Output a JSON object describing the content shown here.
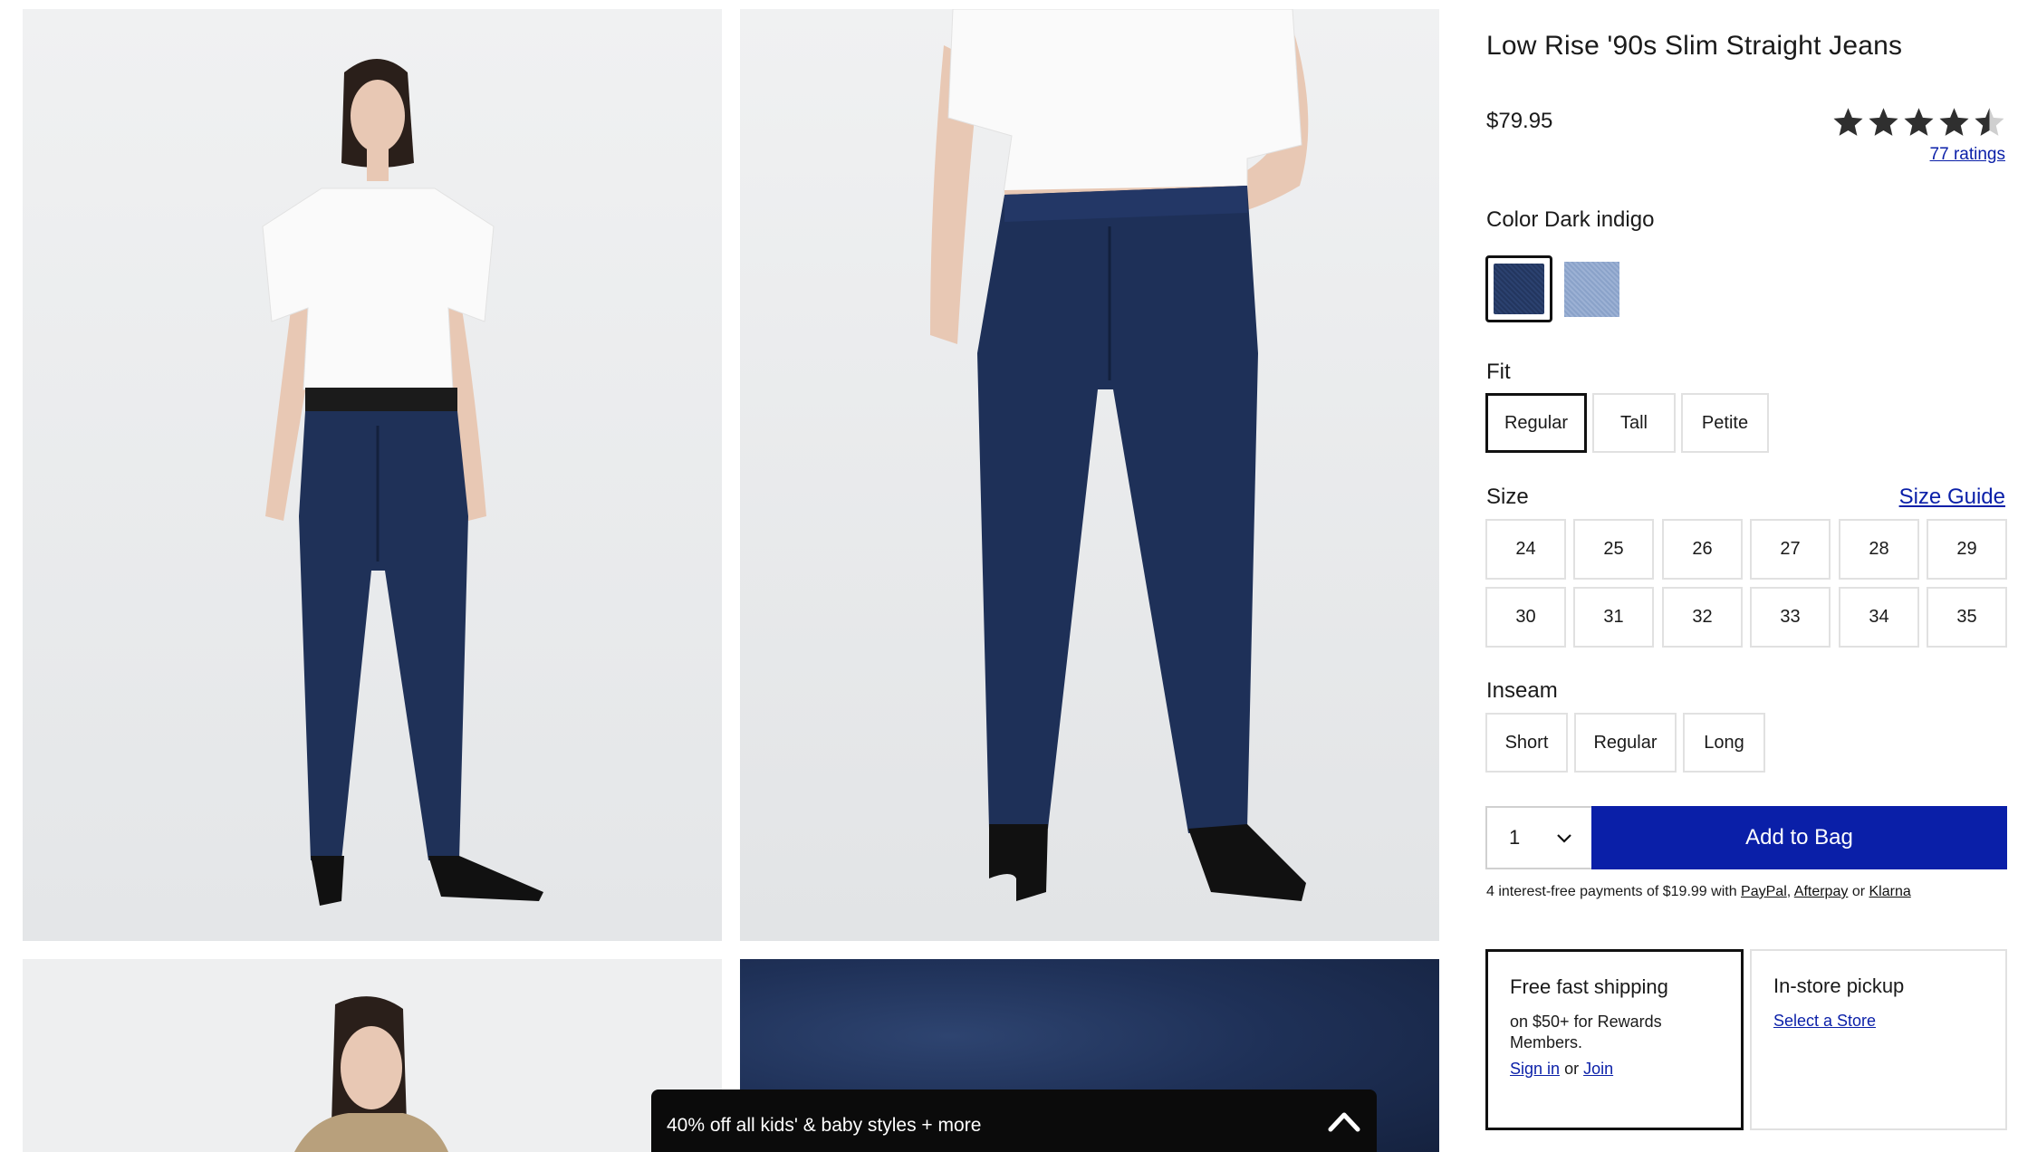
{
  "gallery": {
    "images": [
      {
        "alt": "front-full-view"
      },
      {
        "alt": "front-waist-view"
      },
      {
        "alt": "outerwear-view"
      },
      {
        "alt": "denim-fabric-detail"
      }
    ]
  },
  "promo": {
    "text": "40% off all kids' & baby styles + more",
    "icon": "chevron-up-icon"
  },
  "product": {
    "title": "Low Rise '90s Slim Straight Jeans",
    "price": "$79.95",
    "rating": 4.5,
    "rating_max": 5,
    "ratings_link": "77 ratings",
    "star_icon": "star-icon"
  },
  "color": {
    "label": "Color",
    "selected": "Dark indigo",
    "swatches": [
      {
        "name": "dark-indigo",
        "hex": "#27395f",
        "selected": true
      },
      {
        "name": "light-wash",
        "hex": "#93aacf",
        "selected": false
      }
    ]
  },
  "fit": {
    "label": "Fit",
    "options": [
      "Regular",
      "Tall",
      "Petite"
    ],
    "selected": "Regular"
  },
  "size": {
    "label": "Size",
    "guide_link": "Size Guide",
    "options": [
      "24",
      "25",
      "26",
      "27",
      "28",
      "29",
      "30",
      "31",
      "32",
      "33",
      "34",
      "35"
    ]
  },
  "inseam": {
    "label": "Inseam",
    "options": [
      "Short",
      "Regular",
      "Long"
    ]
  },
  "purchase": {
    "quantity": "1",
    "quantity_icon": "chevron-down-icon",
    "add_to_bag": "Add to Bag",
    "payments_prefix": "4 interest-free payments of $19.99 with",
    "paypal": "PayPal",
    "comma": ",",
    "afterpay": "Afterpay",
    "or": "or",
    "klarna": "Klarna"
  },
  "shipping": {
    "title": "Free fast shipping",
    "body": "on $50+ for Rewards Members.",
    "sign_in": "Sign in",
    "or": "or",
    "join": "Join"
  },
  "pickup": {
    "title": "In-store pickup",
    "select_store": "Select a Store"
  },
  "colors": {
    "accent": "#0a1fa8",
    "promo_bg": "#0b0b0b",
    "star": "#2f2f2f",
    "photo_bg": "#eeeff0"
  }
}
